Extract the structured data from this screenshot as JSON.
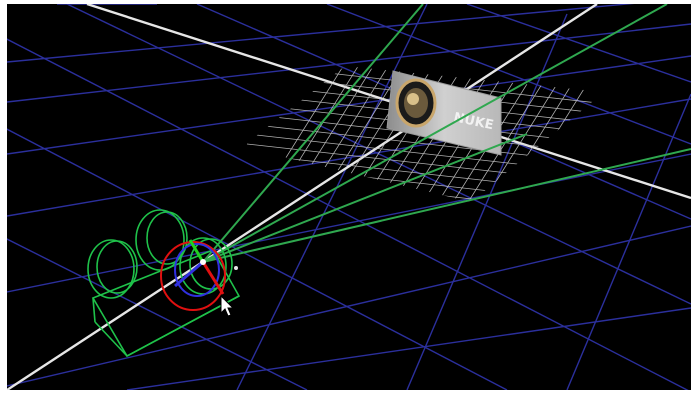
{
  "scene": {
    "background_color": "#000000",
    "floor_grid_color": "#2b2f9c",
    "axis_color": "#e6e6e6",
    "frustum_color": "#2fa84f",
    "camera_color": "#1fc24a",
    "image_grid_color": "#cfcfcf",
    "gizmo_colors": {
      "x": "#e01010",
      "y": "#20d020",
      "z": "#3030e0"
    }
  },
  "image_plane": {
    "card_label": "NUKE",
    "logo_icon": "nuke-logo-icon"
  },
  "cursor": {
    "icon": "mouse-pointer-icon"
  }
}
